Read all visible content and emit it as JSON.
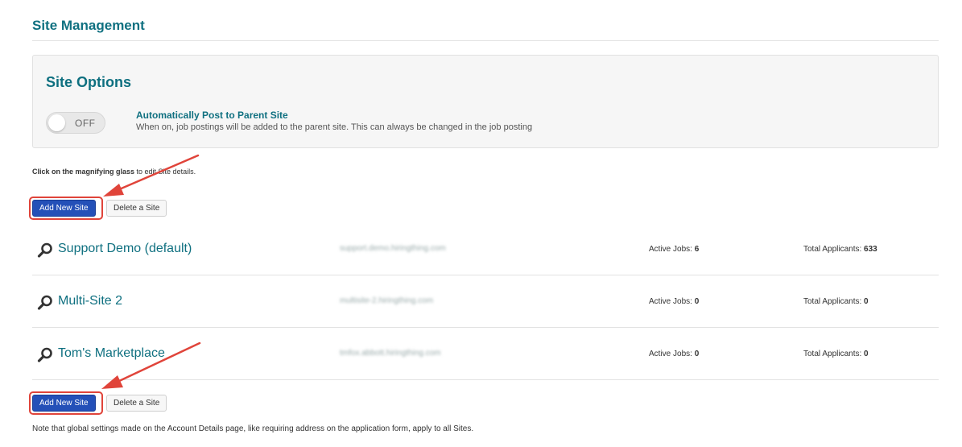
{
  "header": {
    "title": "Site Management"
  },
  "options": {
    "title": "Site Options",
    "toggle_state": "OFF",
    "auto_post_title": "Automatically Post to Parent Site",
    "auto_post_desc": "When on, job postings will be added to the parent site. This can always be changed in the job posting"
  },
  "instructions": {
    "bold_part": "Click on the magnifying glass",
    "rest": " to edit Site details."
  },
  "buttons": {
    "add_label": "Add New Site",
    "delete_label": "Delete a Site"
  },
  "sites": [
    {
      "name": "Support Demo (default)",
      "url": "support.demo.hiringthing.com",
      "active_label": "Active Jobs:",
      "active_jobs": "6",
      "applicants_label": "Total Applicants:",
      "total_applicants": "633"
    },
    {
      "name": "Multi-Site 2",
      "url": "multisite-2.hiringthing.com",
      "active_label": "Active Jobs:",
      "active_jobs": "0",
      "applicants_label": "Total Applicants:",
      "total_applicants": "0"
    },
    {
      "name": "Tom's Marketplace",
      "url": "tmfox.abbott.hiringthing.com",
      "active_label": "Active Jobs:",
      "active_jobs": "0",
      "applicants_label": "Total Applicants:",
      "total_applicants": "0"
    }
  ],
  "note": "Note that global settings made on the Account Details page, like requiring address on the application form, apply to all Sites.",
  "colors": {
    "accent": "#0f7080",
    "primary_button": "#2450b8",
    "annotation": "#e0443a"
  },
  "icons": {
    "site_edit": "magnifying-glass-icon"
  }
}
